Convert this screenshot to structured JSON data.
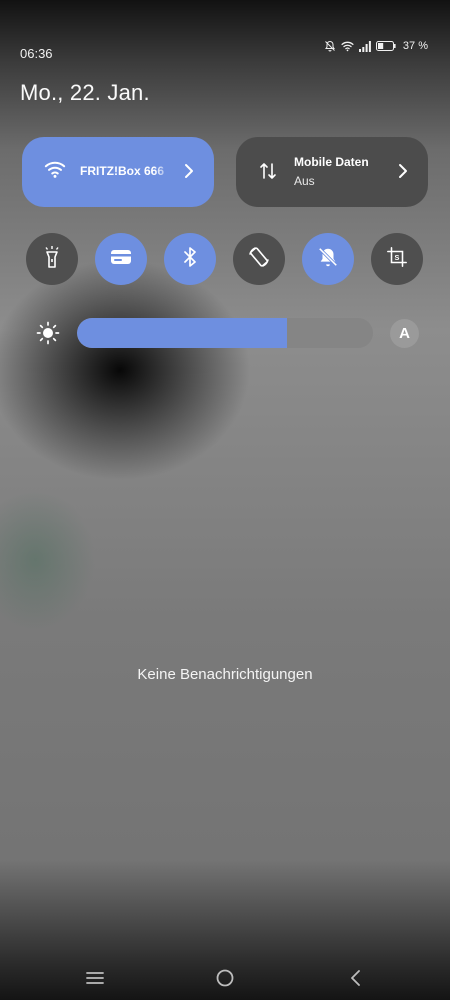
{
  "status_bar": {
    "time": "06:36",
    "battery_percent": "37 %",
    "battery_level": 0.37,
    "icons": [
      "notifications-off-icon",
      "wifi-icon",
      "signal-icon",
      "battery-icon"
    ]
  },
  "date": "Mo., 22. Jan.",
  "tiles": {
    "wifi": {
      "label": "FRITZ!Box 666",
      "icon": "wifi-icon",
      "active": true
    },
    "mobile_data": {
      "label": "Mobile Daten",
      "status": "Aus",
      "icon": "data-arrows-icon",
      "active": false
    }
  },
  "toggles": [
    {
      "name": "flashlight",
      "icon": "flashlight-icon",
      "active": false
    },
    {
      "name": "wallet",
      "icon": "wallet-icon",
      "active": true
    },
    {
      "name": "bluetooth",
      "icon": "bluetooth-icon",
      "active": true
    },
    {
      "name": "auto-rotate",
      "icon": "rotate-icon",
      "active": false
    },
    {
      "name": "silent",
      "icon": "bell-off-icon",
      "active": true
    },
    {
      "name": "screenshot",
      "icon": "screenshot-crop-icon",
      "active": false
    }
  ],
  "brightness": {
    "level": 0.71,
    "auto_label": "A"
  },
  "notifications": {
    "empty_text": "Keine Benachrichtigungen"
  },
  "navigation": [
    "menu-icon",
    "home-icon",
    "back-icon"
  ],
  "colors": {
    "accent": "#6e8fe0",
    "tile_inactive": "#4c4c4c",
    "toggle_inactive": "#4f4f4f"
  }
}
